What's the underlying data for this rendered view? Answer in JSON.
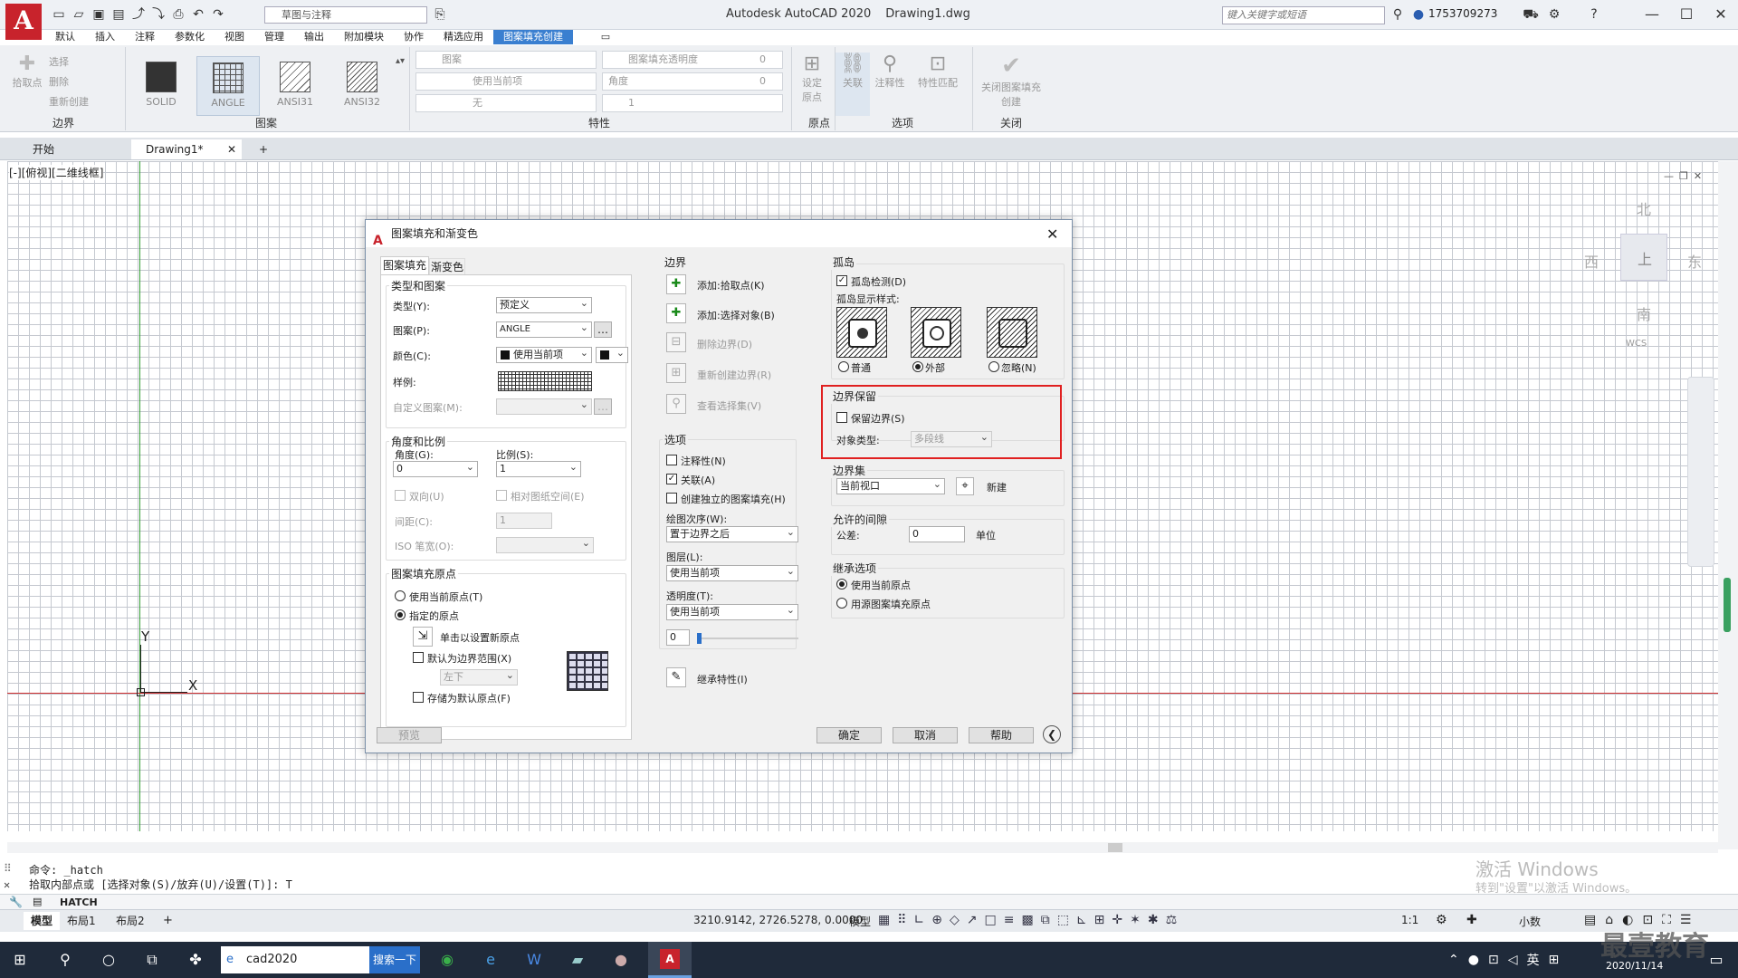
{
  "app": {
    "title": "Autodesk AutoCAD 2020",
    "document": "Drawing1.dwg",
    "logo_letter": "A",
    "workspace": "草图与注释",
    "search_placeholder": "键入关键字或短语",
    "user": "1753709273"
  },
  "menu_tabs": [
    "默认",
    "插入",
    "注释",
    "参数化",
    "视图",
    "管理",
    "输出",
    "附加模块",
    "协作",
    "精选应用",
    "图案填充创建"
  ],
  "ribbon": {
    "boundary_panel": {
      "title": "边界",
      "pick_points": "拾取点",
      "select": "选择",
      "remove": "删除",
      "recreate": "重新创建"
    },
    "pattern_panel": {
      "title": "图案",
      "patterns": [
        "SOLID",
        "ANGLE",
        "ANSI31",
        "ANSI32"
      ]
    },
    "properties_panel": {
      "title": "特性",
      "pattern_type": "图案",
      "transparency_label": "图案填充透明度",
      "transparency_value": "0",
      "color": "使用当前项",
      "angle_label": "角度",
      "angle_value": "0",
      "bg_color": "无",
      "scale_value": "1"
    },
    "origin_panel": {
      "title": "原点",
      "set_origin": "设定原点"
    },
    "options_panel": {
      "title": "选项",
      "associative": "关联",
      "annotative": "注释性",
      "match": "特性匹配"
    },
    "close_panel": {
      "title": "关闭",
      "close": "关闭图案填充创建"
    }
  },
  "doc_tabs": [
    "开始",
    "Drawing1*"
  ],
  "viewport_label": "[-][俯视][二维线框]",
  "viewcube": {
    "north": "北",
    "south": "南",
    "west": "西",
    "east": "东",
    "top": "上",
    "wcs": "WCS"
  },
  "ucs": {
    "x": "X",
    "y": "Y"
  },
  "dialog": {
    "title": "图案填充和渐变色",
    "tabs": [
      "图案填充",
      "渐变色"
    ],
    "type_group": "类型和图案",
    "type_label": "类型(Y):",
    "type_value": "预定义",
    "pattern_label": "图案(P):",
    "pattern_value": "ANGLE",
    "color_label": "颜色(C):",
    "color_value": "使用当前项",
    "swatch_label": "样例:",
    "custom_label": "自定义图案(M):",
    "angle_group": "角度和比例",
    "angle_label": "角度(G):",
    "angle_value": "0",
    "scale_label": "比例(S):",
    "scale_value": "1",
    "double_label": "双向(U)",
    "relative_label": "相对图纸空间(E)",
    "spacing_label": "间距(C):",
    "spacing_value": "1",
    "iso_label": "ISO 笔宽(O):",
    "origin_group": "图案填充原点",
    "use_current_origin": "使用当前原点(T)",
    "specified_origin": "指定的原点",
    "click_set_origin": "单击以设置新原点",
    "default_extents": "默认为边界范围(X)",
    "extent_value": "左下",
    "store_default": "存储为默认原点(F)",
    "boundary_group": "边界",
    "add_pick": "添加:拾取点(K)",
    "add_select": "添加:选择对象(B)",
    "remove_boundary": "删除边界(D)",
    "recreate_boundary": "重新创建边界(R)",
    "view_selection": "查看选择集(V)",
    "options_group": "选项",
    "annotative": "注释性(N)",
    "associative": "关联(A)",
    "separate": "创建独立的图案填充(H)",
    "draw_order_label": "绘图次序(W):",
    "draw_order_value": "置于边界之后",
    "layer_label": "图层(L):",
    "layer_value": "使用当前项",
    "transparency_label": "透明度(T):",
    "transparency_value": "使用当前项",
    "transparency_num": "0",
    "inherit": "继承特性(I)",
    "islands_group": "孤岛",
    "island_detect": "孤岛检测(D)",
    "island_style_label": "孤岛显示样式:",
    "island_normal": "普通",
    "island_outer": "外部",
    "island_ignore": "忽略(N)",
    "retain_group": "边界保留",
    "retain_boundary": "保留边界(S)",
    "object_type_label": "对象类型:",
    "object_type_value": "多段线",
    "boundary_set_group": "边界集",
    "boundary_set_value": "当前视口",
    "new_label": "新建",
    "gap_group": "允许的间隙",
    "tolerance_label": "公差:",
    "tolerance_value": "0",
    "unit_label": "单位",
    "inherit_group": "继承选项",
    "inherit_current": "使用当前原点",
    "inherit_source": "用源图案填充原点",
    "preview": "预览",
    "ok": "确定",
    "cancel": "取消",
    "help": "帮助"
  },
  "command": {
    "line1": "命令:  _hatch",
    "line2": "拾取内部点或 [选择对象(S)/放弃(U)/设置(T)]: T",
    "current": "HATCH"
  },
  "watermark": {
    "line1": "激活 Windows",
    "line2": "转到\"设置\"以激活 Windows。"
  },
  "status": {
    "layout_tabs": [
      "模型",
      "布局1",
      "布局2"
    ],
    "coords": "3210.9142, 2726.5278, 0.0000",
    "model": "模型",
    "scale": "1:1",
    "units": "小数"
  },
  "taskbar": {
    "search_text": "cad2020",
    "search_button": "搜索一下",
    "ime": "英",
    "date": "2020/11/14"
  },
  "brand_watermark": "最壹教育"
}
